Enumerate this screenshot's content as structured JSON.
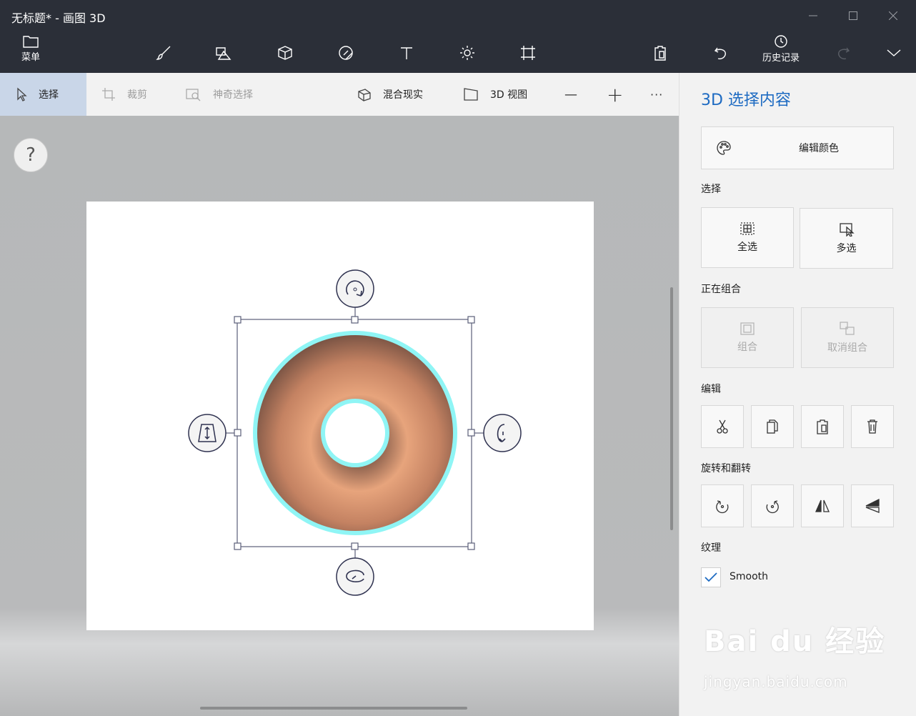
{
  "window": {
    "title": "无标题* - 画图 3D"
  },
  "titlebar": {
    "menu_label": "菜单",
    "history_label": "历史记录"
  },
  "icons": [
    "folder-icon",
    "brush-icon",
    "2d-shapes-icon",
    "3d-shapes-icon",
    "stickers-icon",
    "text-icon",
    "effects-icon",
    "canvas-icon",
    "paste-icon",
    "undo-icon",
    "history-icon",
    "redo-icon",
    "chevron-down-icon"
  ],
  "toolbar": {
    "select_label": "选择",
    "crop_label": "裁剪",
    "magic_select_label": "神奇选择",
    "mixed_reality_label": "混合现实",
    "view3d_label": "3D 视图",
    "zoom_out": "—",
    "zoom_in": "+",
    "more": "···"
  },
  "canvas": {
    "help": "?"
  },
  "panel": {
    "title": "3D 选择内容",
    "edit_color_label": "编辑颜色",
    "select_section": "选择",
    "select_all_label": "全选",
    "multi_select_label": "多选",
    "grouping_section": "正在组合",
    "group_label": "组合",
    "ungroup_label": "取消组合",
    "edit_section": "编辑",
    "rotate_section": "旋转和翻转",
    "texture_section": "纹理",
    "smooth_label": "Smooth",
    "smooth_checked": true
  },
  "colors": {
    "accent": "#1e6bc2",
    "titlebar": "#2b2f38",
    "donut": "#c98462",
    "selection_glow": "#8ff5f5"
  },
  "watermark": {
    "line1": "Bai du 经验",
    "line2": "jingyan.baidu.com"
  }
}
